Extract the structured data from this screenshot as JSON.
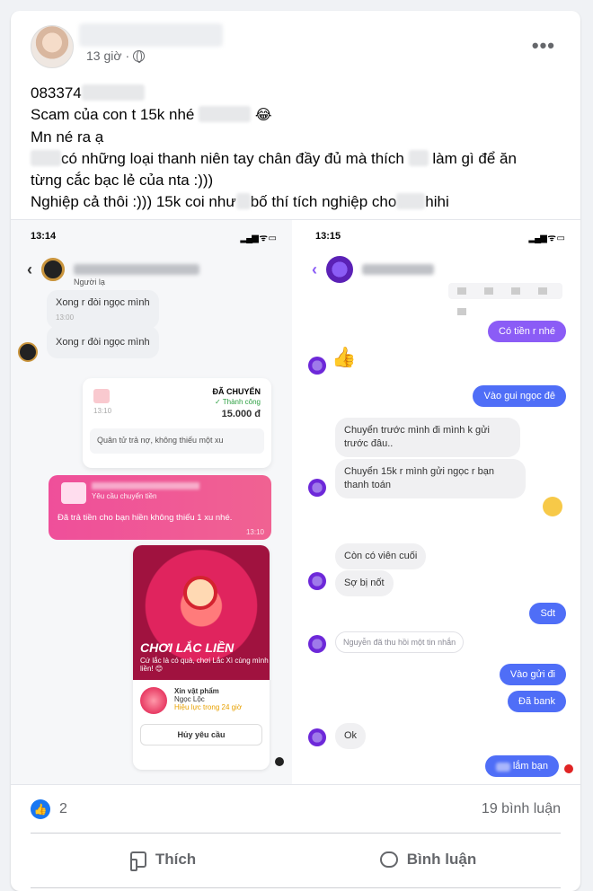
{
  "post": {
    "time": "13 giờ",
    "privacy_dot": "·",
    "more": "•••",
    "lines": {
      "l1": "083374",
      "l2a": "Scam của con t 15k nhé",
      "l2_emoji": "😂",
      "l3": "Mn né ra ạ",
      "l4a": "có những loại thanh niên tay chân đầy đủ mà thích",
      "l4b": "làm gì để ăn",
      "l5": "từng cắc bạc lẻ của nta :)))",
      "l6a": "Nghiệp cả thôi :))) 15k coi như",
      "l6b": "bố thí tích nghiệp cho",
      "l6c": "hihi"
    }
  },
  "left_shot": {
    "time": "13:14",
    "signal": "▂▄▆ ᯤ ▭",
    "back": "‹",
    "subtitle": "Người lạ",
    "msg1": "Xong r đòi ngọc mình",
    "msg1_time": "13:00",
    "msg2": "Xong r đòi ngọc mình",
    "transfer": {
      "title": "ĐÃ CHUYỂN",
      "status": "✓ Thành công",
      "amount": "15.000 đ",
      "time": "13:10",
      "note": "Quân tử trả nợ, không thiếu một xu"
    },
    "pink": {
      "request": "Yêu cầu chuyển tiền",
      "message": "Đã trả tiền cho bạn hiền không thiếu 1 xu nhé.",
      "time": "13:10"
    },
    "promo": {
      "headline": "CHƠI LẮC LIỀN",
      "sub": "Cứ lắc là có quà, chơi Lắc Xì cùng mình liền! 😊",
      "item_title": "Xin vật phẩm",
      "item_name": "Ngọc Lộc",
      "item_valid": "Hiệu lực trong 24 giờ",
      "cancel": "Hủy yêu cầu"
    }
  },
  "right_shot": {
    "time": "13:15",
    "signal": "▂▄▆ ᯤ ▭",
    "back": "‹",
    "m1": "Có tiền r nhé",
    "thumb": "👍",
    "m2": "Vào gui ngọc đê",
    "m3": "Chuyển trước mình đi mình k gửi trước đâu..",
    "m4": "Chuyển 15k r mình gửi ngọc r bạn thanh toán",
    "m5": "Còn có viên cuối",
    "m6": "Sợ bị nốt",
    "m7": "Sdt",
    "recall": "Nguyễn đã thu hồi một tin nhắn",
    "m8": "Vào gửi đi",
    "m9": "Đã bank",
    "m10": "Ok",
    "m11": "lắm bạn"
  },
  "footer": {
    "like_icon": "👍",
    "reaction_count": "2",
    "comment_count": "19 bình luận",
    "like_label": "Thích",
    "comment_label": "Bình luận"
  }
}
